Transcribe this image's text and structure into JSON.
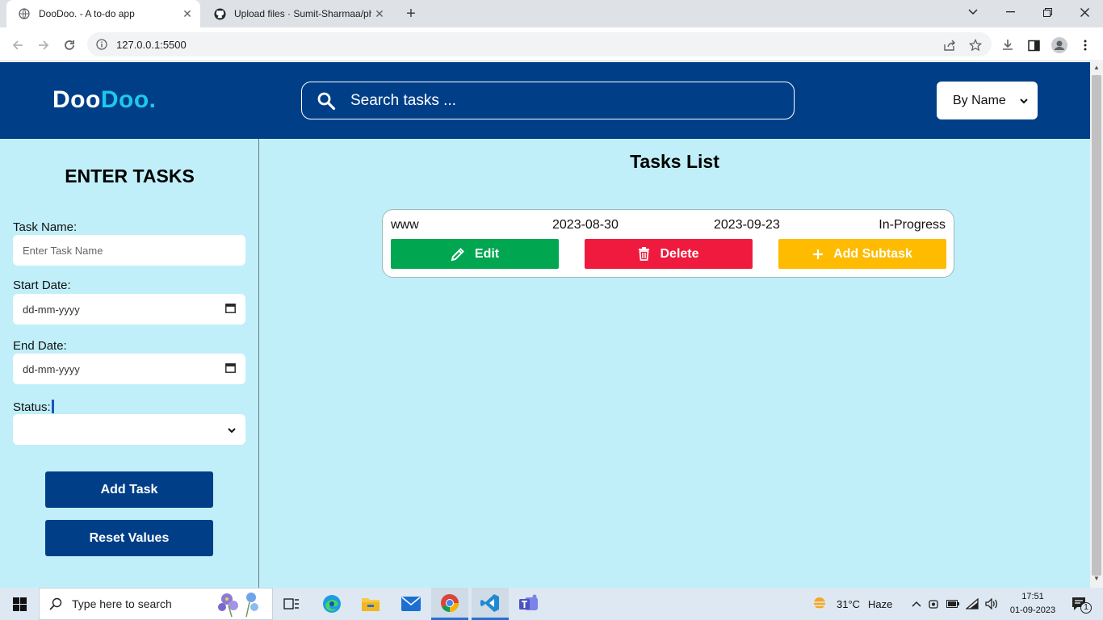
{
  "browser": {
    "tabs": [
      {
        "title": "DooDoo. - A to-do app",
        "close": "✕"
      },
      {
        "title": "Upload files · Sumit-Sharmaa/pha",
        "close": "✕"
      }
    ],
    "new_tab": "+",
    "url": "127.0.0.1:5500"
  },
  "app": {
    "logo_part1": "Doo",
    "logo_part2": "Doo.",
    "search_placeholder": "Search tasks ...",
    "sort_value": "By Name",
    "sidebar": {
      "title": "ENTER TASKS",
      "task_name_label": "Task Name:",
      "task_name_placeholder": "Enter Task Name",
      "start_date_label": "Start Date:",
      "start_date_value": "dd-mm-yyyy",
      "end_date_label": "End Date:",
      "end_date_value": "dd-mm-yyyy",
      "status_label": "Status:",
      "status_value": "",
      "add_button": "Add Task",
      "reset_button": "Reset Values"
    },
    "main": {
      "title": "Tasks List",
      "tasks": [
        {
          "name": "www",
          "start": "2023-08-30",
          "end": "2023-09-23",
          "status": "In-Progress",
          "edit_label": "Edit",
          "delete_label": "Delete",
          "subtask_label": "Add Subtask"
        }
      ]
    },
    "colors": {
      "header": "#003f88",
      "accent": "#1ec8ec",
      "background": "#c1eff9",
      "edit": "#00a650",
      "delete": "#ef1a3d",
      "subtask": "#ffbb00"
    }
  },
  "taskbar": {
    "search_placeholder": "Type here to search",
    "weather_temp": "31°C",
    "weather_text": "Haze",
    "time": "17:51",
    "date": "01-09-2023",
    "notification_count": "1"
  }
}
